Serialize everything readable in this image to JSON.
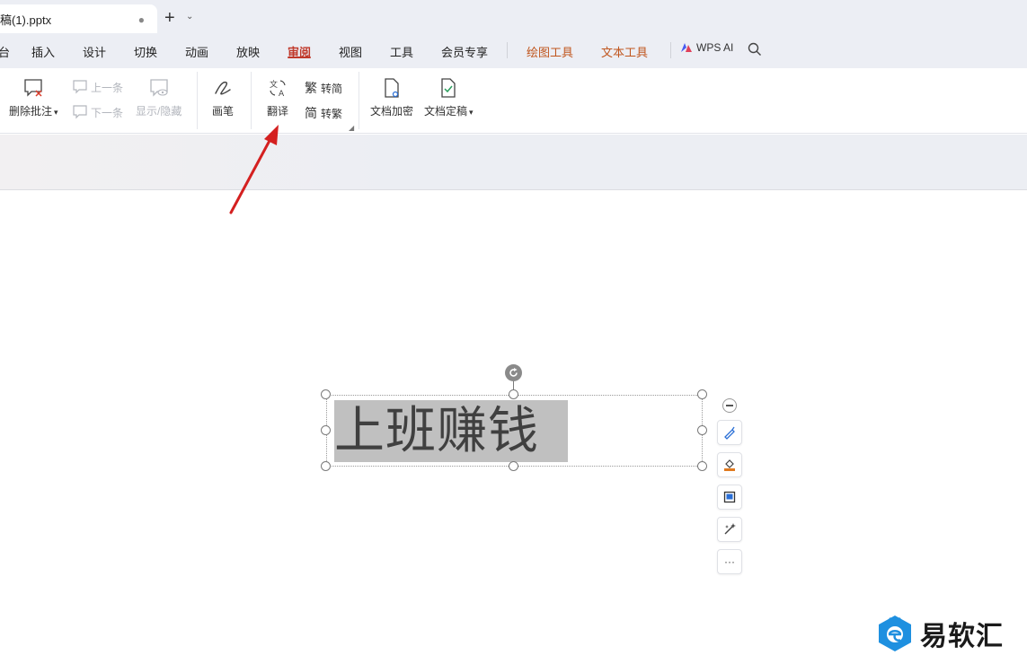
{
  "tabbar": {
    "doc_title": "稿(1).pptx",
    "modified_dot": "●",
    "new_tab": "+",
    "new_tab_menu": "⌄"
  },
  "menu": {
    "items": [
      "台",
      "插入",
      "设计",
      "切换",
      "动画",
      "放映",
      "审阅",
      "视图",
      "工具",
      "会员专享",
      "绘图工具",
      "文本工具"
    ],
    "active": "审阅",
    "ai_label": "WPS AI"
  },
  "ribbon": {
    "delete_comment": "删除批注",
    "prev": "上一条",
    "next": "下一条",
    "show_hide": "显示/隐藏",
    "pen": "画笔",
    "translate": "翻译",
    "to_simplified": "转简",
    "to_traditional": "转繁",
    "simp_icon_char": "繁",
    "trad_icon_char": "简",
    "encrypt": "文档加密",
    "finalize": "文档定稿"
  },
  "slide": {
    "text": "上班赚钱"
  },
  "floating_toolbar": [
    "pen-style-icon",
    "fill-icon",
    "outline-icon",
    "effects-icon",
    "more-icon"
  ],
  "more_label": "···",
  "watermark": {
    "text": "易软汇"
  },
  "colors": {
    "accent_red": "#c0392b",
    "tool_orange": "#c0561e",
    "arrow_red": "#d42020",
    "watermark_blue": "#1e90e0"
  }
}
